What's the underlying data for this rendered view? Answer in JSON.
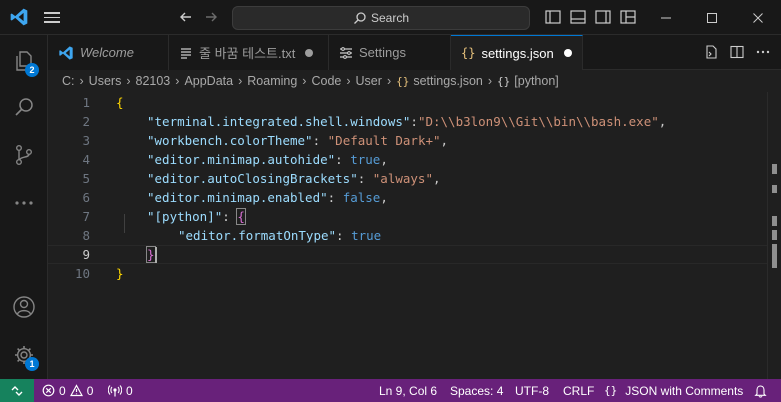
{
  "titlebar": {
    "search_label": "Search"
  },
  "activity": {
    "explorer_badge": "2",
    "settings_badge": "1"
  },
  "tabs": [
    {
      "label": "Welcome"
    },
    {
      "label": "줄 바꿈 테스트.txt"
    },
    {
      "label": "Settings"
    },
    {
      "label": "settings.json"
    }
  ],
  "breadcrumb": {
    "items": [
      "C:",
      "Users",
      "82103",
      "AppData",
      "Roaming",
      "Code",
      "User",
      "settings.json",
      "[python]"
    ]
  },
  "editor": {
    "line_numbers": [
      "1",
      "2",
      "3",
      "4",
      "5",
      "6",
      "7",
      "8",
      "9",
      "10"
    ],
    "lines": [
      {
        "open": "{"
      },
      {
        "key": "\"terminal.integrated.shell.windows\"",
        "colon": ":",
        "value": "\"D:\\\\b3lon9\\\\Git\\\\bin\\\\bash.exe\"",
        "tail": ","
      },
      {
        "key": "\"workbench.colorTheme\"",
        "colon": ": ",
        "value": "\"Default Dark+\"",
        "tail": ","
      },
      {
        "key": "\"editor.minimap.autohide\"",
        "colon": ": ",
        "value": "true",
        "tail": ","
      },
      {
        "key": "\"editor.autoClosingBrackets\"",
        "colon": ": ",
        "value": "\"always\"",
        "tail": ","
      },
      {
        "key": "\"editor.minimap.enabled\"",
        "colon": ": ",
        "value": "false",
        "tail": ","
      },
      {
        "key": "\"[python]\"",
        "colon": ": ",
        "value": "{"
      },
      {
        "key": "\"editor.formatOnType\"",
        "colon": ": ",
        "value": "true"
      },
      {
        "value": "}"
      },
      {
        "value": "}"
      }
    ]
  },
  "status": {
    "errors": "0",
    "warnings": "0",
    "ports": "0",
    "position": "Ln 9, Col 6",
    "spaces": "Spaces: 4",
    "encoding": "UTF-8",
    "eol": "CRLF",
    "language": "JSON with Comments"
  },
  "colors": {
    "status_bar": "#68217a",
    "remote": "#16825d",
    "accent": "#0078d4",
    "json_key": "#9cdcfe",
    "json_string": "#ce9178",
    "json_keyword": "#569cd6",
    "bracket_level1": "#ffd700",
    "bracket_level2": "#da70d6"
  },
  "icons": [
    "vscode-logo-icon",
    "menu-icon",
    "arrow-left-icon",
    "arrow-right-icon",
    "search-icon",
    "toggle-sidebar-icon",
    "toggle-panel-icon",
    "toggle-secondary-sidebar-icon",
    "customize-layout-icon",
    "minimize-icon",
    "maximize-icon",
    "close-icon",
    "files-icon",
    "search-view-icon",
    "source-control-icon",
    "more-icon",
    "account-icon",
    "manage-gear-icon",
    "vscode-tab-icon",
    "text-file-icon",
    "settings-tab-icon",
    "json-braces-icon",
    "open-settings-json-icon",
    "split-editor-icon",
    "more-actions-icon",
    "remote-icon",
    "error-icon",
    "warning-icon",
    "ports-icon",
    "braces-icon",
    "bell-icon"
  ]
}
